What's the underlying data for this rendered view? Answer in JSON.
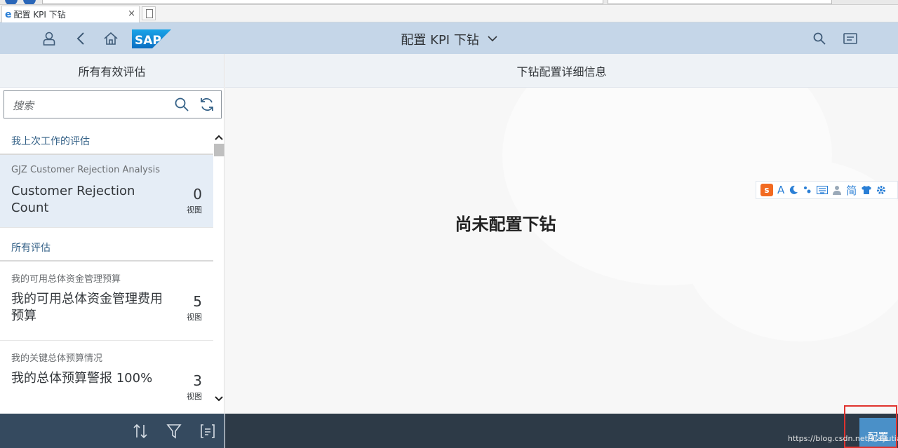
{
  "browser": {
    "tab_title": "配置 KPI 下钻",
    "tab_close": "×"
  },
  "shell": {
    "title": "配置 KPI 下钻",
    "logo_text": "SAP"
  },
  "left_panel": {
    "header": "所有有效评估",
    "search_placeholder": "搜索",
    "groups": [
      {
        "label": "我上次工作的评估",
        "items": [
          {
            "subtitle": "GJZ Customer Rejection Analysis",
            "title": "Customer Rejection Count",
            "count": "0",
            "unit": "视图"
          }
        ]
      },
      {
        "label": "所有评估",
        "items": [
          {
            "subtitle": "我的可用总体资金管理预算",
            "title": "我的可用总体资金管理费用预算",
            "count": "5",
            "unit": "视图"
          },
          {
            "subtitle": "我的关键总体预算情况",
            "title": "我的总体预算警报 100%",
            "count": "3",
            "unit": "视图"
          }
        ]
      }
    ]
  },
  "right_panel": {
    "header": "下钻配置详细信息",
    "empty_message": "尚未配置下钻"
  },
  "ime_toolbar": {
    "simplified_label": "简",
    "font_label": "A"
  },
  "footer": {
    "configure_label": "配置",
    "watermark": "https://blog.csdn.net/xiayutian_c"
  },
  "colors": {
    "shell_bg": "#c5d6e8",
    "footer_bg": "#354a5f",
    "accent": "#4a90c8",
    "highlight": "#e0332e"
  }
}
